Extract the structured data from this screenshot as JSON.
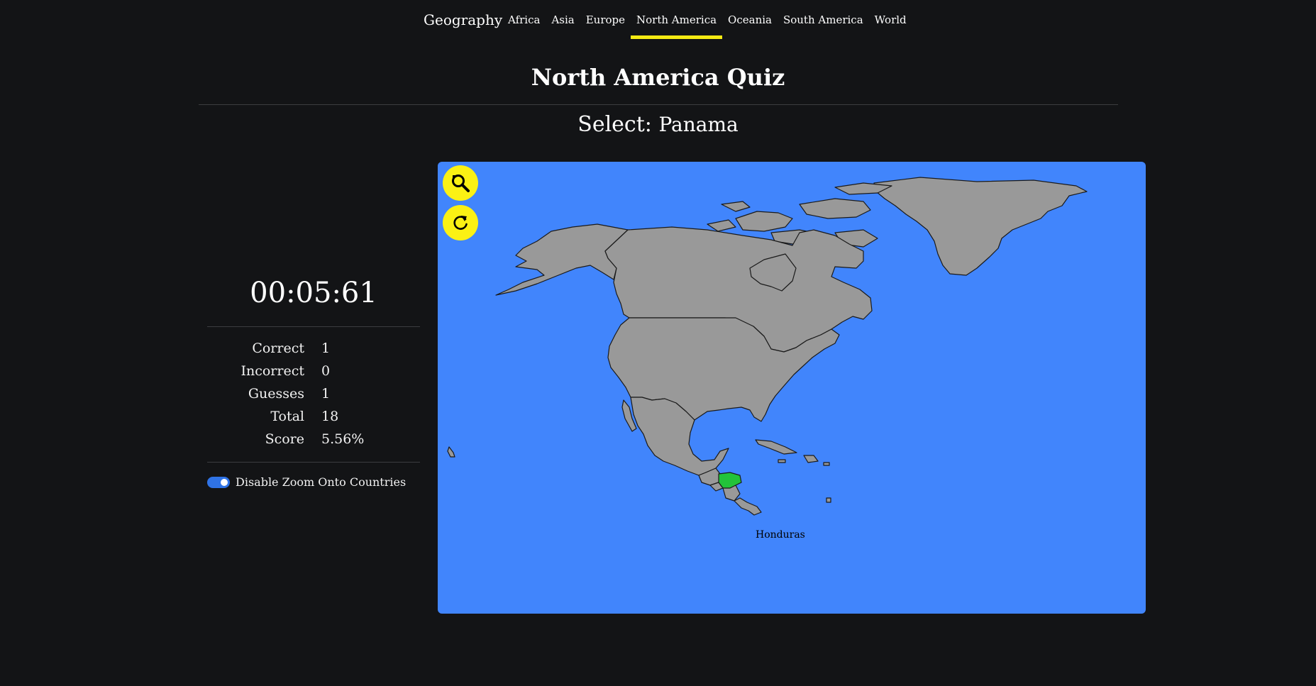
{
  "nav": {
    "brand": "Geography",
    "links": [
      {
        "label": "Africa"
      },
      {
        "label": "Asia"
      },
      {
        "label": "Europe"
      },
      {
        "label": "North America"
      },
      {
        "label": "Oceania"
      },
      {
        "label": "South America"
      },
      {
        "label": "World"
      }
    ],
    "active": "North America",
    "active_color": "#f5ea13"
  },
  "page": {
    "title": "North America Quiz",
    "select_prefix": "Select:",
    "select_target": "Panama"
  },
  "sidebar": {
    "timer": "00:05:61",
    "stats": [
      {
        "label": "Correct",
        "value": "1"
      },
      {
        "label": "Incorrect",
        "value": "0"
      },
      {
        "label": "Guesses",
        "value": "1"
      },
      {
        "label": "Total",
        "value": "18"
      },
      {
        "label": "Score",
        "value": "5.56%"
      }
    ],
    "toggle": {
      "label": "Disable Zoom Onto Countries",
      "on": true
    }
  },
  "map": {
    "ocean_color": "#4185fc",
    "land_color": "#999999",
    "highlight_color": "#22c33a",
    "button_color": "#fbf114",
    "buttons": [
      {
        "icon": "zoom-reset-icon"
      },
      {
        "icon": "refresh-icon"
      }
    ],
    "highlighted_country": "Honduras"
  }
}
